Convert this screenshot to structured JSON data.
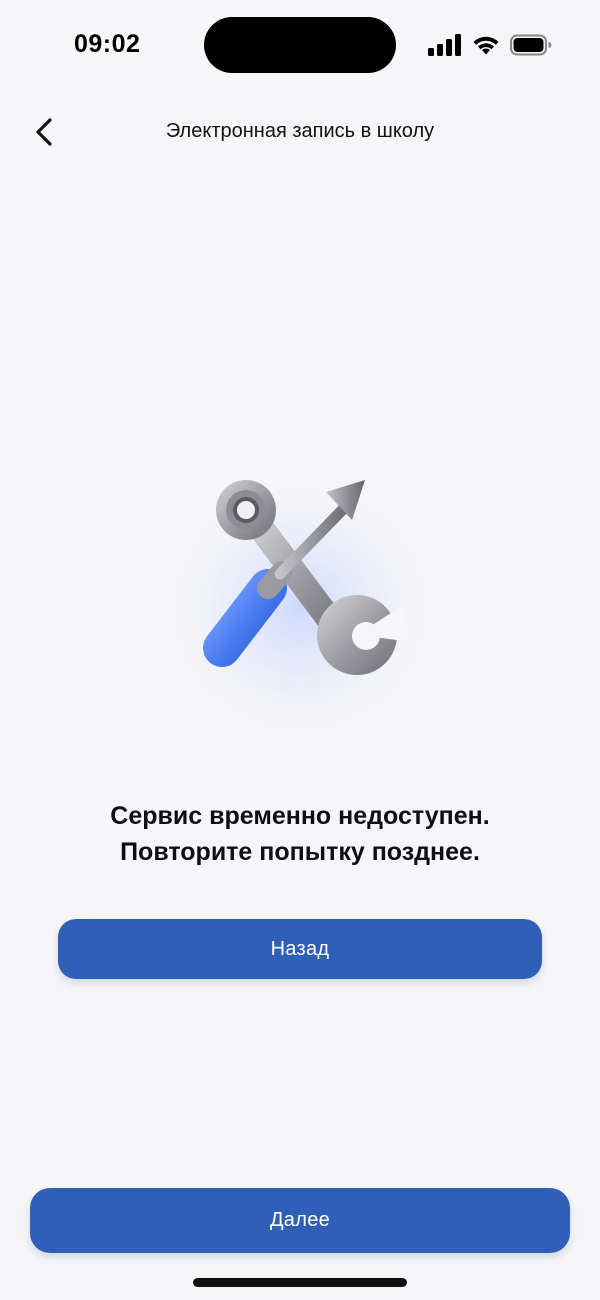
{
  "status_bar": {
    "time": "09:02",
    "icons": [
      "cellular-signal-icon",
      "wifi-icon",
      "battery-icon"
    ]
  },
  "nav": {
    "title": "Электронная запись в школу",
    "back_icon": "chevron-left-icon"
  },
  "illustration": {
    "icon": "wrench-screwdriver-icon",
    "accent_color": "#4a7cf0"
  },
  "message": {
    "line1": "Сервис временно недоступен.",
    "line2": "Повторите попытку позднее."
  },
  "buttons": {
    "back_label": "Назад",
    "next_label": "Далее"
  },
  "colors": {
    "background": "#f6f6f8",
    "primary_button": "#2f5fb7",
    "button_text": "#ffffff"
  }
}
